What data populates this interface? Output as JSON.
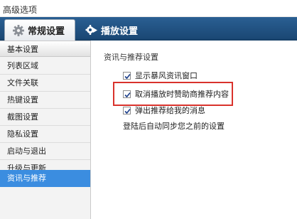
{
  "window": {
    "title": "高级选项"
  },
  "tabs": [
    {
      "label": "常规设置",
      "icon": "gear-icon"
    },
    {
      "label": "播放设置",
      "icon": "play-settings-icon"
    }
  ],
  "sidebar": {
    "items": [
      {
        "label": "基本设置"
      },
      {
        "label": "列表区域"
      },
      {
        "label": "文件关联"
      },
      {
        "label": "热键设置"
      },
      {
        "label": "截图设置"
      },
      {
        "label": "隐私设置"
      },
      {
        "label": "启动与退出"
      },
      {
        "label": "升级与更新"
      },
      {
        "label": "资讯与推荐"
      }
    ],
    "active_index": 8
  },
  "panel": {
    "title": "资讯与推荐设置",
    "options": [
      {
        "label": "显示暴风资讯窗口",
        "checked": true
      },
      {
        "label": "取消播放时赞助商推荐内容",
        "checked": true
      },
      {
        "label": "弹出推荐给我的消息",
        "checked": true
      }
    ],
    "note": "登陆后自动同步您之前的设置"
  },
  "colors": {
    "highlight": "#d9322c",
    "active": "#3b8de0",
    "tab_bar": "#1f4f80"
  }
}
